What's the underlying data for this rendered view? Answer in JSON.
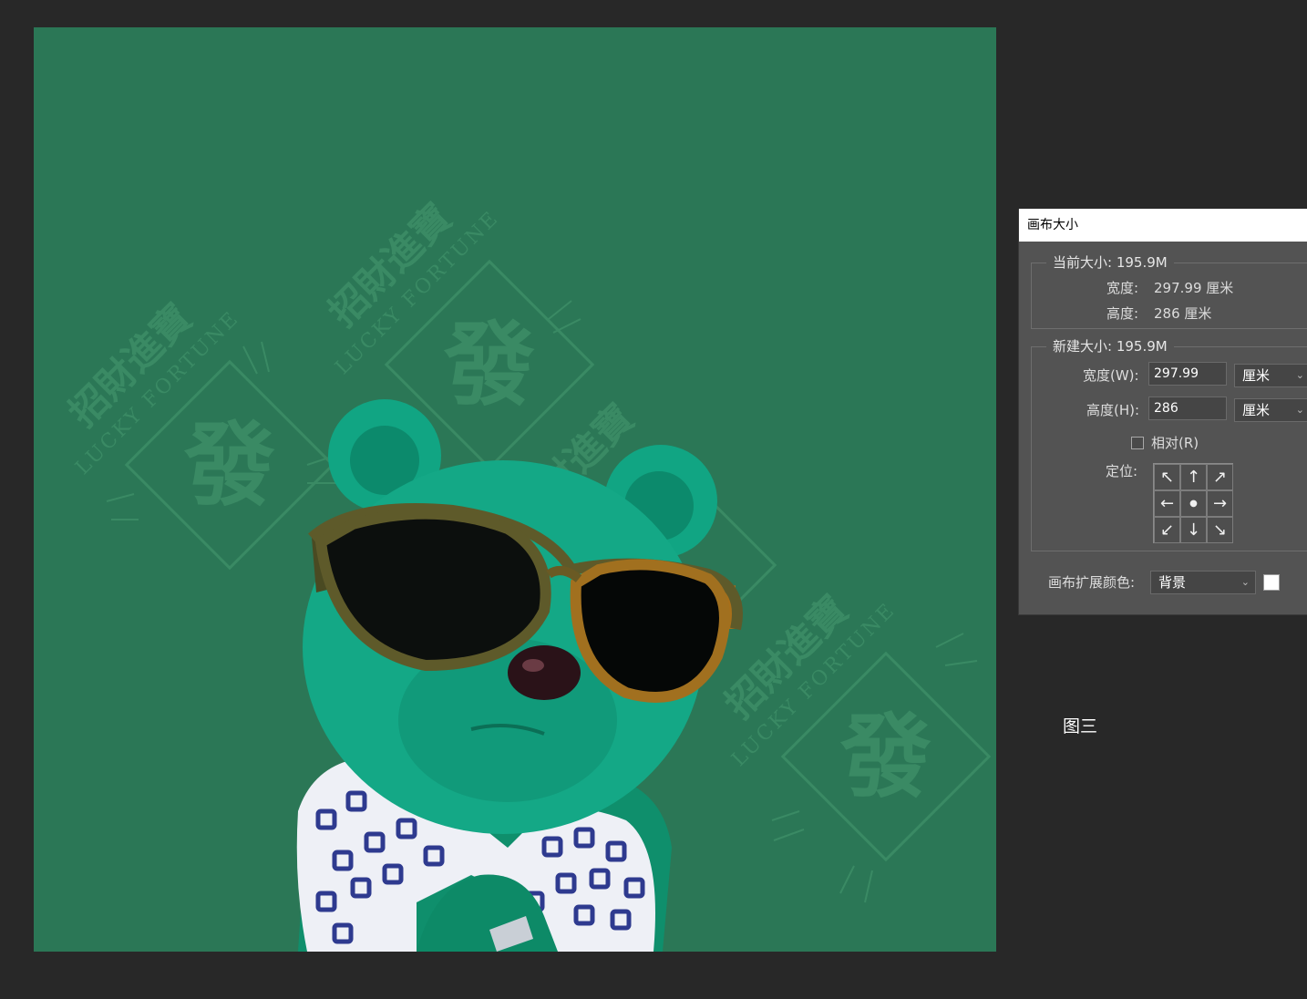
{
  "dialog": {
    "title": "画布大小",
    "current_size": {
      "legend": "当前大小: 195.9M",
      "width_label": "宽度:",
      "width_value": "297.99 厘米",
      "height_label": "高度:",
      "height_value": "286 厘米"
    },
    "new_size": {
      "legend": "新建大小: 195.9M",
      "width_label": "宽度(W):",
      "width_value": "297.99",
      "width_unit": "厘米",
      "height_label": "高度(H):",
      "height_value": "286",
      "height_unit": "厘米",
      "relative_label": "相对(R)",
      "relative_checked": false,
      "anchor_label": "定位:",
      "anchor_arrows": [
        "↖",
        "↑",
        "↗",
        "←",
        "●",
        "→",
        "↙",
        "↓",
        "↘"
      ]
    },
    "extension_color": {
      "label": "画布扩展颜色:",
      "value": "背景",
      "swatch_color": "#ffffff"
    }
  },
  "canvas": {
    "background_color": "#2b7756",
    "watermark_cn": "招財進寶",
    "watermark_en": "LUCKY FORTUNE",
    "watermark_big": "發"
  },
  "caption": "图三"
}
